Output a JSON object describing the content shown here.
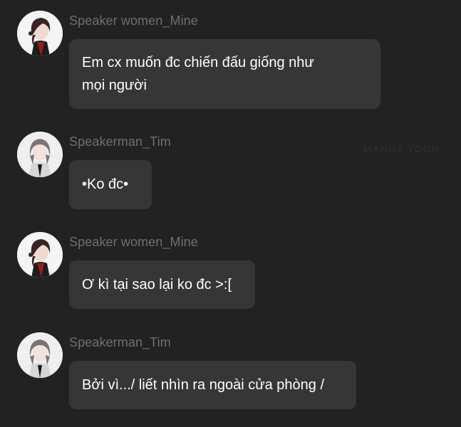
{
  "messages": [
    {
      "sender": "Speaker women_Mine",
      "text": "Em cx muốn đc chiến đấu giống như\nmọi người",
      "avatar": "female-avatar"
    },
    {
      "sender": "Speakerman_Tim",
      "text": "•Ko đc•",
      "avatar": "male-avatar"
    },
    {
      "sender": "Speaker women_Mine",
      "text": "Ơ kì tại sao lại ko đc >:[",
      "avatar": "female-avatar"
    },
    {
      "sender": "Speakerman_Tim",
      "text": "Bởi vì.../ liết nhìn ra ngoài cửa phòng /",
      "avatar": "male-avatar"
    }
  ],
  "watermark": "MANGA TOON",
  "colors": {
    "background": "#222222",
    "bubble": "#363636",
    "sender_text": "#6f6f6f",
    "message_text": "#ffffff"
  }
}
